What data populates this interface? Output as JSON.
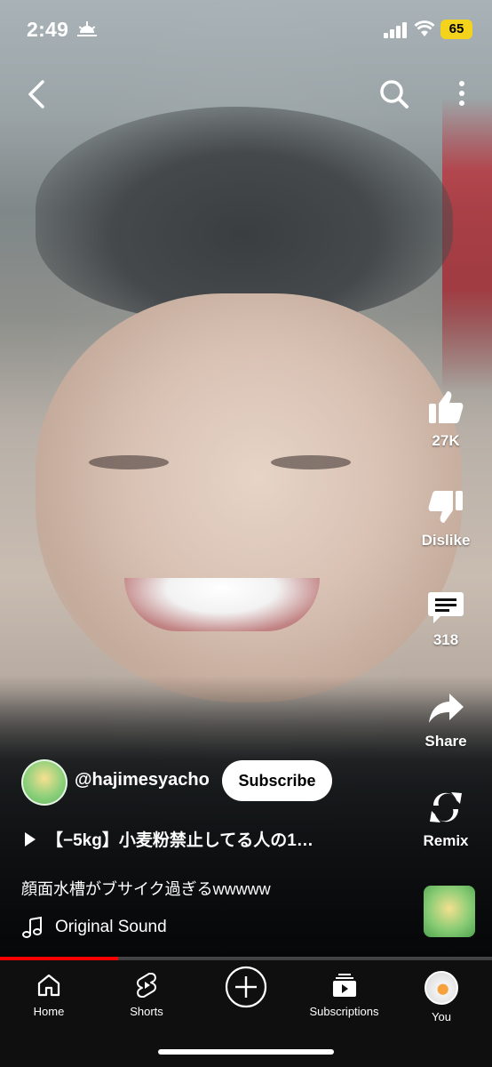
{
  "status_bar": {
    "time": "2:49",
    "battery": "65",
    "battery_color": "#F3D31B"
  },
  "top_bar": {
    "back_icon": "chevron-left-icon",
    "search_icon": "search-icon",
    "more_icon": "more-vertical-icon"
  },
  "actions": {
    "like_count": "27K",
    "dislike_label": "Dislike",
    "comments_count": "318",
    "share_label": "Share",
    "remix_label": "Remix"
  },
  "channel": {
    "handle": "@hajimesyacho",
    "subscribe_label": "Subscribe"
  },
  "video": {
    "related_title": "【−5kg】小麦粉禁止してる人の1…",
    "description": "顔面水槽がブサイク過ぎるwwwww",
    "sound_label": "Original Sound",
    "progress_fraction": 0.24,
    "accent_color": "#FF0000"
  },
  "bottom_nav": {
    "home": "Home",
    "shorts": "Shorts",
    "subscriptions": "Subscriptions",
    "you": "You"
  }
}
